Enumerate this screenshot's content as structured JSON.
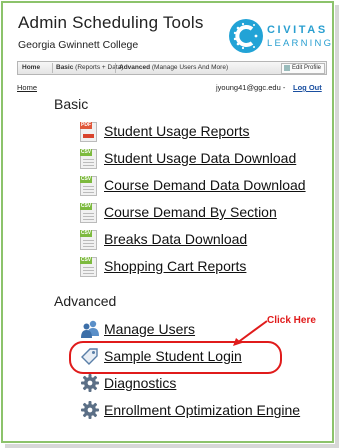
{
  "header": {
    "title": "Admin Scheduling Tools",
    "subtitle": "Georgia Gwinnett College",
    "logo": {
      "name": "CIVITAS",
      "tagline": "LEARNING"
    }
  },
  "navbar": {
    "home": "Home",
    "basic_bold": "Basic",
    "basic_desc": "(Reports + Data)",
    "advanced_bold": "Advanced",
    "advanced_desc": "(Manage Users And More)",
    "edit_profile": "Edit Profile"
  },
  "userbar": {
    "home_link": "Home",
    "email": "jyoung41@ggc.edu -",
    "logout": "Log Out"
  },
  "sections": {
    "basic": {
      "title": "Basic",
      "items": [
        {
          "label": "Student Usage Reports",
          "icon": "pdf-file-icon"
        },
        {
          "label": "Student Usage Data Download",
          "icon": "csv-file-icon"
        },
        {
          "label": "Course Demand Data Download",
          "icon": "csv-file-icon"
        },
        {
          "label": "Course Demand By Section",
          "icon": "csv-file-icon"
        },
        {
          "label": "Breaks Data Download",
          "icon": "csv-file-icon"
        },
        {
          "label": "Shopping Cart Reports",
          "icon": "csv-file-icon"
        }
      ]
    },
    "advanced": {
      "title": "Advanced",
      "items": [
        {
          "label": "Manage Users",
          "icon": "users-icon"
        },
        {
          "label": "Sample Student Login",
          "icon": "tag-icon"
        },
        {
          "label": "Diagnostics",
          "icon": "gear-icon"
        },
        {
          "label": "Enrollment Optimization Engine",
          "icon": "gear-icon"
        }
      ]
    }
  },
  "annotation": {
    "text": "Click Here",
    "color": "#e01b1b"
  },
  "colors": {
    "frame": "#8cc36b",
    "brand": "#22a3d6",
    "csv": "#7dba3e",
    "pdf": "#e0573a"
  }
}
